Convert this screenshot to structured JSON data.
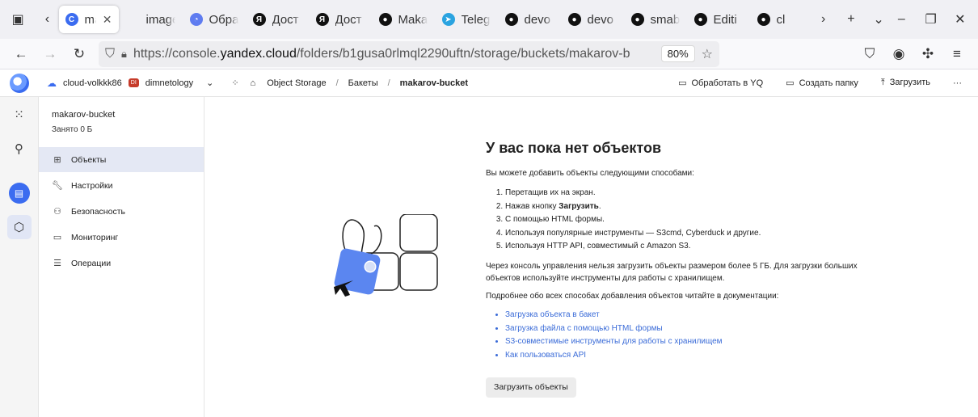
{
  "browser": {
    "tabs": [
      {
        "title": "ma",
        "favicon": "cloud-icon",
        "color": "#3b6cf0",
        "active": true
      },
      {
        "title": "images.j",
        "favicon": "none",
        "color": "#ffffff",
        "active": false
      },
      {
        "title": "Обра",
        "favicon": "circle-icon",
        "color": "#5f7cf0",
        "active": false
      },
      {
        "title": "Дост",
        "favicon": "yandex-icon",
        "color": "#111111",
        "active": false
      },
      {
        "title": "Дост",
        "favicon": "yandex-icon",
        "color": "#111111",
        "active": false
      },
      {
        "title": "Maka",
        "favicon": "github-icon",
        "color": "#111111",
        "active": false
      },
      {
        "title": "Teleg",
        "favicon": "telegram-icon",
        "color": "#2aa3e0",
        "active": false
      },
      {
        "title": "devo",
        "favicon": "github-icon",
        "color": "#111111",
        "active": false
      },
      {
        "title": "devo",
        "favicon": "github-icon",
        "color": "#111111",
        "active": false
      },
      {
        "title": "smab",
        "favicon": "github-icon",
        "color": "#111111",
        "active": false
      },
      {
        "title": "Editi",
        "favicon": "github-icon",
        "color": "#111111",
        "active": false
      },
      {
        "title": "cl",
        "favicon": "github-icon",
        "color": "#111111",
        "active": false
      }
    ],
    "url_prefix": "https://console.",
    "url_domain": "yandex.cloud",
    "url_rest": "/folders/b1gusa0rlmql2290uftn/storage/buckets/makarov-b",
    "zoom": "80%"
  },
  "header": {
    "cloud": "cloud-volkkk86",
    "folder_badge": "DI",
    "folder": "dimnetology",
    "service": "Object Storage",
    "crumb_buckets": "Бакеты",
    "crumb_bucket": "makarov-bucket",
    "action_yq": "Обработать в YQ",
    "action_folder": "Создать папку",
    "action_upload": "Загрузить",
    "more": "···"
  },
  "sidebar": {
    "bucket_name": "makarov-bucket",
    "usage": "Занято 0 Б",
    "items": [
      {
        "label": "Объекты",
        "icon": "objects-icon",
        "active": true
      },
      {
        "label": "Настройки",
        "icon": "wrench-icon",
        "active": false
      },
      {
        "label": "Безопасность",
        "icon": "users-icon",
        "active": false
      },
      {
        "label": "Мониторинг",
        "icon": "monitor-icon",
        "active": false
      },
      {
        "label": "Операции",
        "icon": "list-icon",
        "active": false
      }
    ]
  },
  "empty": {
    "title": "У вас пока нет объектов",
    "intro": "Вы можете добавить объекты следующими способами:",
    "steps": [
      "Перетащив их на экран.",
      "Нажав кнопку ",
      "С помощью HTML формы.",
      "Используя популярные инструменты — S3cmd, Cyberduck и другие.",
      "Используя HTTP API, совместимый с Amazon S3."
    ],
    "step2_bold": "Загрузить",
    "step2_tail": ".",
    "limit_note": "Через консоль управления нельзя загрузить объекты размером более 5 ГБ. Для загрузки больших объектов используйте инструменты для работы с хранилищем.",
    "docs_note": "Подробнее обо всех способах добавления объектов читайте в документации:",
    "links": [
      "Загрузка объекта в бакет",
      "Загрузка файла с помощью HTML формы",
      "S3-совместимые инструменты для работы с хранилищем",
      "Как пользоваться API"
    ],
    "button": "Загрузить объекты"
  },
  "colors": {
    "accent": "#3b6cf0",
    "link": "#3b6cd8",
    "sidebar_active": "#e4e8f4"
  }
}
